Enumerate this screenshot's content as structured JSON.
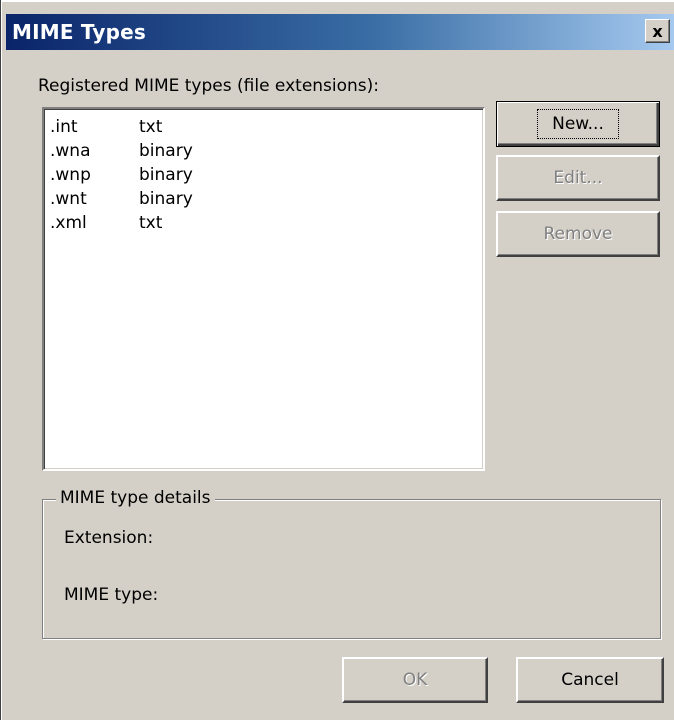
{
  "window": {
    "title": "MIME Types",
    "close_glyph": "x",
    "titlebar_colors": [
      "#0a246a",
      "#a6caf0"
    ]
  },
  "list": {
    "label": "Registered MIME types (file extensions):",
    "items": [
      {
        "extension": ".int",
        "type": "txt"
      },
      {
        "extension": ".wna",
        "type": "binary"
      },
      {
        "extension": ".wnp",
        "type": "binary"
      },
      {
        "extension": ".wnt",
        "type": "binary"
      },
      {
        "extension": ".xml",
        "type": "txt"
      }
    ]
  },
  "buttons": {
    "new_label": "New...",
    "edit_label": "Edit...",
    "remove_label": "Remove",
    "ok_label": "OK",
    "cancel_label": "Cancel"
  },
  "details": {
    "title": "MIME type details",
    "extension_label": "Extension:",
    "mime_type_label": "MIME type:"
  }
}
